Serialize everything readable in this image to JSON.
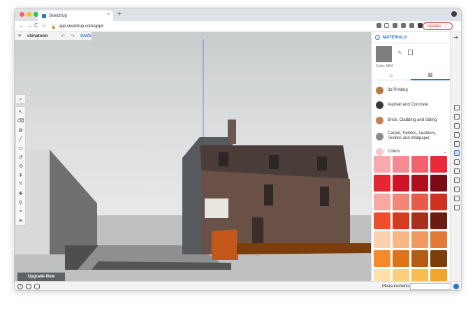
{
  "browser": {
    "tab_title": "SketchUp",
    "tab_close": "×",
    "new_tab": "+",
    "url": "app.sketchup.com/app#",
    "update_label": "Update",
    "update_menu": "⋮",
    "nav": {
      "back": "←",
      "forward": "→",
      "reload": "C",
      "home": "⌂"
    }
  },
  "app": {
    "menu_icon": "≡",
    "document_name": "chinatown",
    "undo": "↶",
    "redo": "↷",
    "save_label": "SAVE",
    "upgrade_label": "Upgrade Now",
    "measurements_label": "Measurements",
    "measurements_value": "",
    "tools": [
      "↖",
      "⌫",
      "◍",
      "╱",
      "▭",
      "↺",
      "⟲",
      "⇞",
      "⤧",
      "✥",
      "⚲",
      "⌖",
      "≋"
    ],
    "search_tool": "🔍"
  },
  "materials": {
    "title": "MATERIALS",
    "current_color_id": "Color: M04",
    "current_color": "#7e7e7e",
    "tabs": [
      {
        "icon": "⌂",
        "name": "home"
      },
      {
        "icon": "▧",
        "name": "edit"
      }
    ],
    "categories": [
      {
        "label": "3d Printing",
        "color": "#b27b45"
      },
      {
        "label": "Asphalt and Concrete",
        "color": "#3a3a3e"
      },
      {
        "label": "Brick, Cladding and Siding",
        "color": "#c7824f"
      },
      {
        "label": "Carpet, Fabrics, Leathers, Textiles and Wallpaper",
        "color": "#8e8a86"
      },
      {
        "label": "Colors",
        "color": "#f6c9cc"
      }
    ],
    "colors_chevron": "⌄",
    "palette": [
      "#f8a9ad",
      "#f58b93",
      "#f2616c",
      "#ea2a3a",
      "#e62630",
      "#cf1525",
      "#b0101e",
      "#7a0a16",
      "#f7a8a2",
      "#f38679",
      "#e85a49",
      "#cf3220",
      "#ed4e2c",
      "#d33d1f",
      "#a8301a",
      "#6a1c0f",
      "#fbd1b0",
      "#f7b787",
      "#f19a60",
      "#e27a36",
      "#f58a2a",
      "#e07319",
      "#b45c12",
      "#7c3f0c",
      "#fde1a8",
      "#fbd07c",
      "#f8bd4e",
      "#f1a52a"
    ]
  }
}
